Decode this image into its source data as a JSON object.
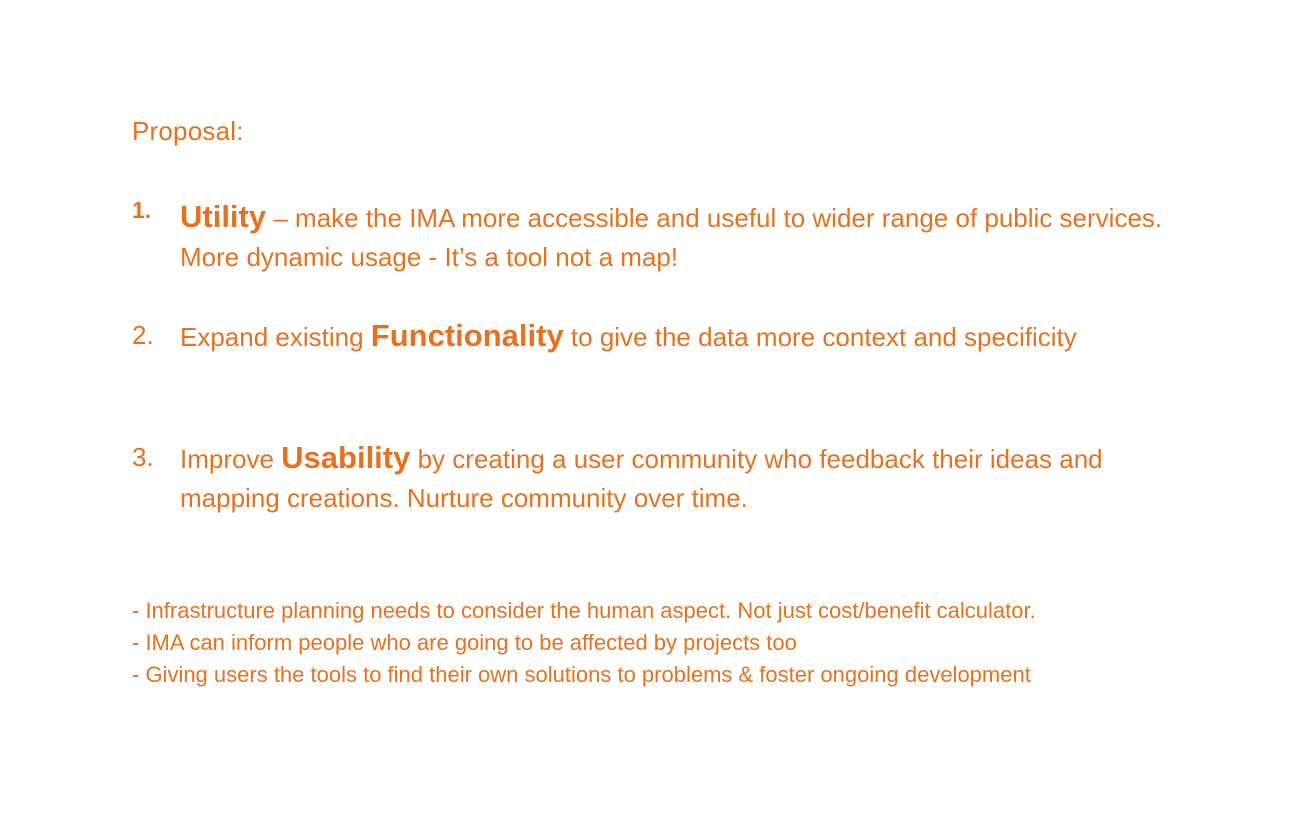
{
  "slide": {
    "heading": "Proposal:",
    "items": [
      {
        "number": "1.",
        "keyword": "Utility",
        "prefix": "",
        "suffix": " – make the IMA more accessible and useful to wider range of public services. More dynamic usage - It’s a tool not a map!"
      },
      {
        "number": "2.",
        "prefix": "Expand existing ",
        "keyword": "Functionality",
        "suffix": " to give the data more context and specificity"
      },
      {
        "number": "3.",
        "prefix": "Improve ",
        "keyword": "Usability",
        "suffix": " by creating a user community who feedback their ideas and mapping creations. Nurture community over time."
      }
    ],
    "notes": [
      "- Infrastructure planning needs to consider the human aspect. Not just cost/benefit calculator.",
      "- IMA can inform people who are going to be affected by projects too",
      "- Giving users the tools to find their own solutions to problems & foster ongoing development"
    ]
  },
  "colors": {
    "text": "#e8711f",
    "background": "#ffffff"
  }
}
